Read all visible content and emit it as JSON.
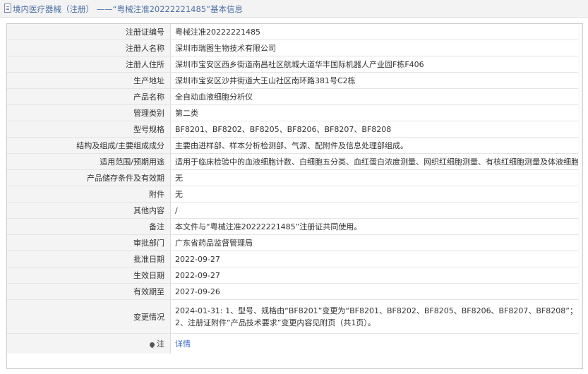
{
  "header": {
    "title": "境内医疗器械（注册） ——“粤械注准20222221485”基本信息"
  },
  "rows": [
    {
      "label": "注册证编号",
      "value": "粤械注准20222221485"
    },
    {
      "label": "注册人名称",
      "value": "深圳市瑞图生物技术有限公司"
    },
    {
      "label": "注册人住所",
      "value": "深圳市宝安区西乡街道南昌社区航城大道华丰国际机器人产业园F栋F406"
    },
    {
      "label": "生产地址",
      "value": "深圳市宝安区沙井街道大王山社区南环路381号C2栋"
    },
    {
      "label": "产品名称",
      "value": "全自动血液细胞分析仪"
    },
    {
      "label": "管理类别",
      "value": "第二类"
    },
    {
      "label": "型号规格",
      "value": "BF8201、BF8202、BF8205、BF8206、BF8207、BF8208"
    },
    {
      "label": "结构及组成/主要组成成分",
      "value": "主要由进样部、样本分析检测部、气源、配附件及信息处理部组成。"
    },
    {
      "label": "适用范围/预期用途",
      "value": "适用于临床检验中的血液细胞计数、白细胞五分类、血红蛋白浓度测量、网织红细胞测量、有核红细胞测量及体液细胞测量。"
    },
    {
      "label": "产品储存条件及有效期",
      "value": "无"
    },
    {
      "label": "附件",
      "value": "无"
    },
    {
      "label": "其他内容",
      "value": "/"
    },
    {
      "label": "备注",
      "value": "本文件与“粤械注准20222221485”注册证共同使用。"
    },
    {
      "label": "审批部门",
      "value": "广东省药品监督管理局"
    },
    {
      "label": "批准日期",
      "value": "2022-09-27"
    },
    {
      "label": "生效日期",
      "value": "2022-09-27"
    },
    {
      "label": "有效期至",
      "value": "2027-09-26"
    }
  ],
  "change_row": {
    "label": "变更情况",
    "line1": "2024-01-31: 1、型号、规格由“BF8201”变更为“BF8201、BF8202、BF8205、BF8206、BF8207、BF8208”；",
    "line2": "2、注册证附件“产品技术要求”变更内容见附页（共1页）。"
  },
  "detail_row": {
    "label": "注",
    "icon": "location-pin-icon",
    "link": "详情"
  }
}
